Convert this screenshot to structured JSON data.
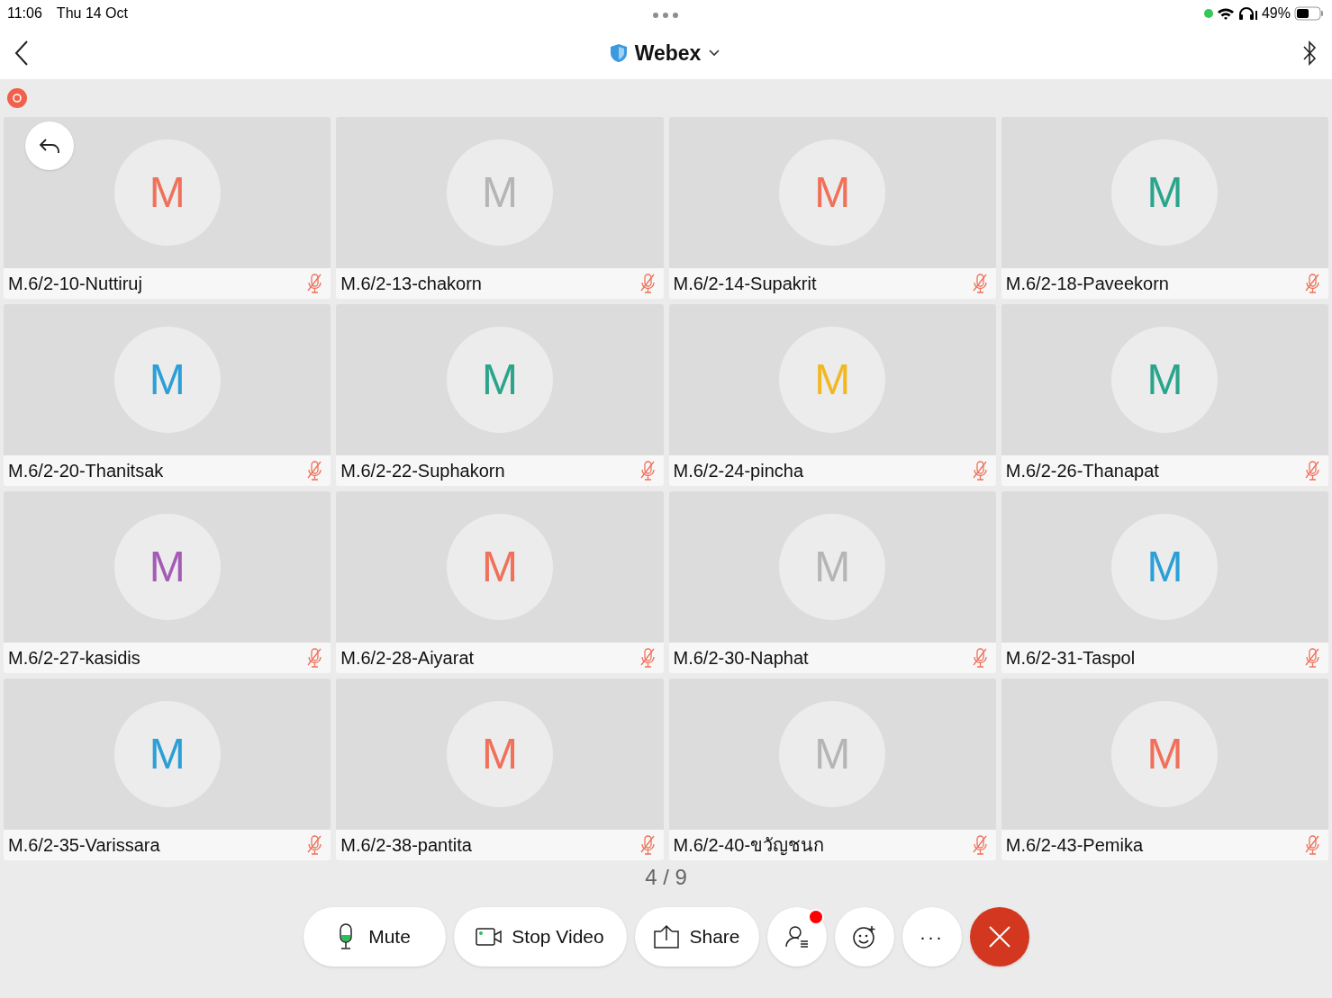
{
  "status_bar": {
    "time": "11:06",
    "date": "Thu 14 Oct",
    "battery": "49%"
  },
  "header": {
    "title": "Webex"
  },
  "recording": true,
  "participants": [
    {
      "name": "M.6/2-10-Nuttiruj",
      "initial": "M",
      "color": "#f0705a",
      "muted": true
    },
    {
      "name": "M.6/2-13-chakorn",
      "initial": "M",
      "color": "#b5b5b5",
      "muted": true
    },
    {
      "name": "M.6/2-14-Supakrit",
      "initial": "M",
      "color": "#f0705a",
      "muted": true
    },
    {
      "name": "M.6/2-18-Paveekorn",
      "initial": "M",
      "color": "#2aa58c",
      "muted": true
    },
    {
      "name": "M.6/2-20-Thanitsak",
      "initial": "M",
      "color": "#2b9fd6",
      "muted": true
    },
    {
      "name": "M.6/2-22-Suphakorn",
      "initial": "M",
      "color": "#2aa58c",
      "muted": true
    },
    {
      "name": "M.6/2-24-pincha",
      "initial": "M",
      "color": "#f2b824",
      "muted": true
    },
    {
      "name": "M.6/2-26-Thanapat",
      "initial": "M",
      "color": "#2aa58c",
      "muted": true
    },
    {
      "name": "M.6/2-27-kasidis",
      "initial": "M",
      "color": "#a35bb5",
      "muted": true
    },
    {
      "name": "M.6/2-28-Aiyarat",
      "initial": "M",
      "color": "#f0705a",
      "muted": true
    },
    {
      "name": "M.6/2-30-Naphat",
      "initial": "M",
      "color": "#b5b5b5",
      "muted": true
    },
    {
      "name": "M.6/2-31-Taspol",
      "initial": "M",
      "color": "#2b9fd6",
      "muted": true
    },
    {
      "name": "M.6/2-35-Varissara",
      "initial": "M",
      "color": "#2b9fd6",
      "muted": true
    },
    {
      "name": "M.6/2-38-pantita",
      "initial": "M",
      "color": "#f0705a",
      "muted": true
    },
    {
      "name": "M.6/2-40-ขวัญชนก",
      "initial": "M",
      "color": "#b5b5b5",
      "muted": true
    },
    {
      "name": "M.6/2-43-Pemika",
      "initial": "M",
      "color": "#f0705a",
      "muted": true
    }
  ],
  "page_indicator": "4 / 9",
  "toolbar": [
    {
      "kind": "mute",
      "label": "Mute"
    },
    {
      "kind": "video",
      "label": "Stop Video"
    },
    {
      "kind": "share",
      "label": "Share"
    },
    {
      "kind": "participants",
      "notification": true
    },
    {
      "kind": "reactions"
    },
    {
      "kind": "more",
      "label": "···"
    },
    {
      "kind": "leave"
    }
  ]
}
